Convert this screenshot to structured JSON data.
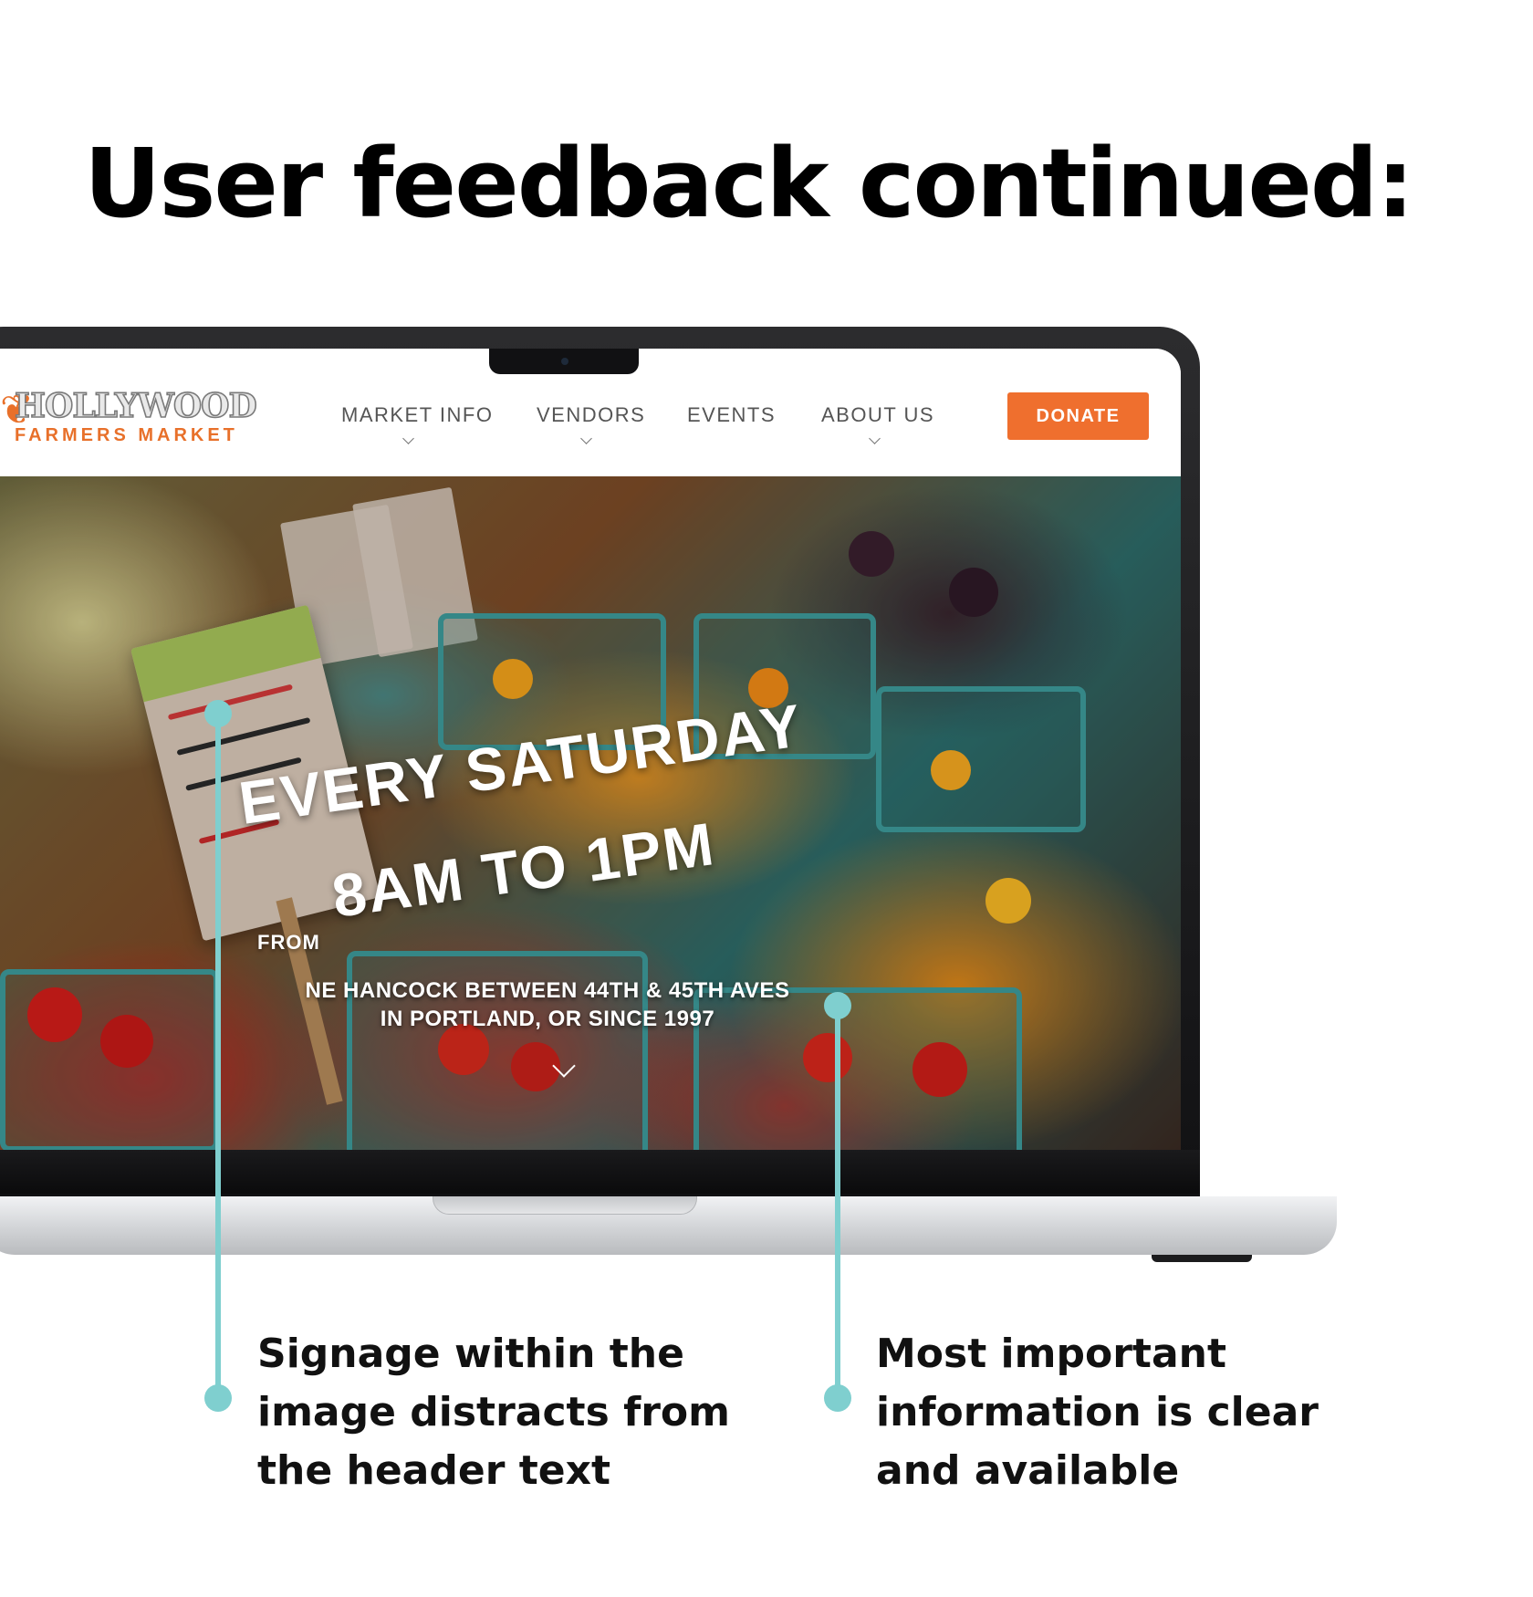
{
  "page": {
    "heading": "User feedback continued:"
  },
  "site": {
    "logo": {
      "wordmark": "HOLLYWOOD",
      "subtitle": "FARMERS MARKET"
    },
    "nav": [
      {
        "label": "MARKET INFO",
        "has_dropdown": true
      },
      {
        "label": "VENDORS",
        "has_dropdown": true
      },
      {
        "label": "EVENTS",
        "has_dropdown": false
      },
      {
        "label": "ABOUT US",
        "has_dropdown": true
      }
    ],
    "donate_label": "DONATE",
    "hero": {
      "headline_line1": "EVERY SATURDAY",
      "from_label": "FROM",
      "headline_line2": "8AM TO 1PM",
      "address_line1": "NE HANCOCK BETWEEN 44TH & 45TH AVES",
      "address_line2": "IN PORTLAND, OR SINCE 1997"
    }
  },
  "annotations": [
    {
      "text_lines": [
        "Signage within the",
        "image distracts from",
        "the header text"
      ]
    },
    {
      "text_lines": [
        "Most important",
        "information is clear",
        "and available"
      ]
    }
  ],
  "colors": {
    "accent_orange": "#ef6f2e",
    "annotation_teal": "#7fcfcf",
    "heading_black": "#000000"
  }
}
